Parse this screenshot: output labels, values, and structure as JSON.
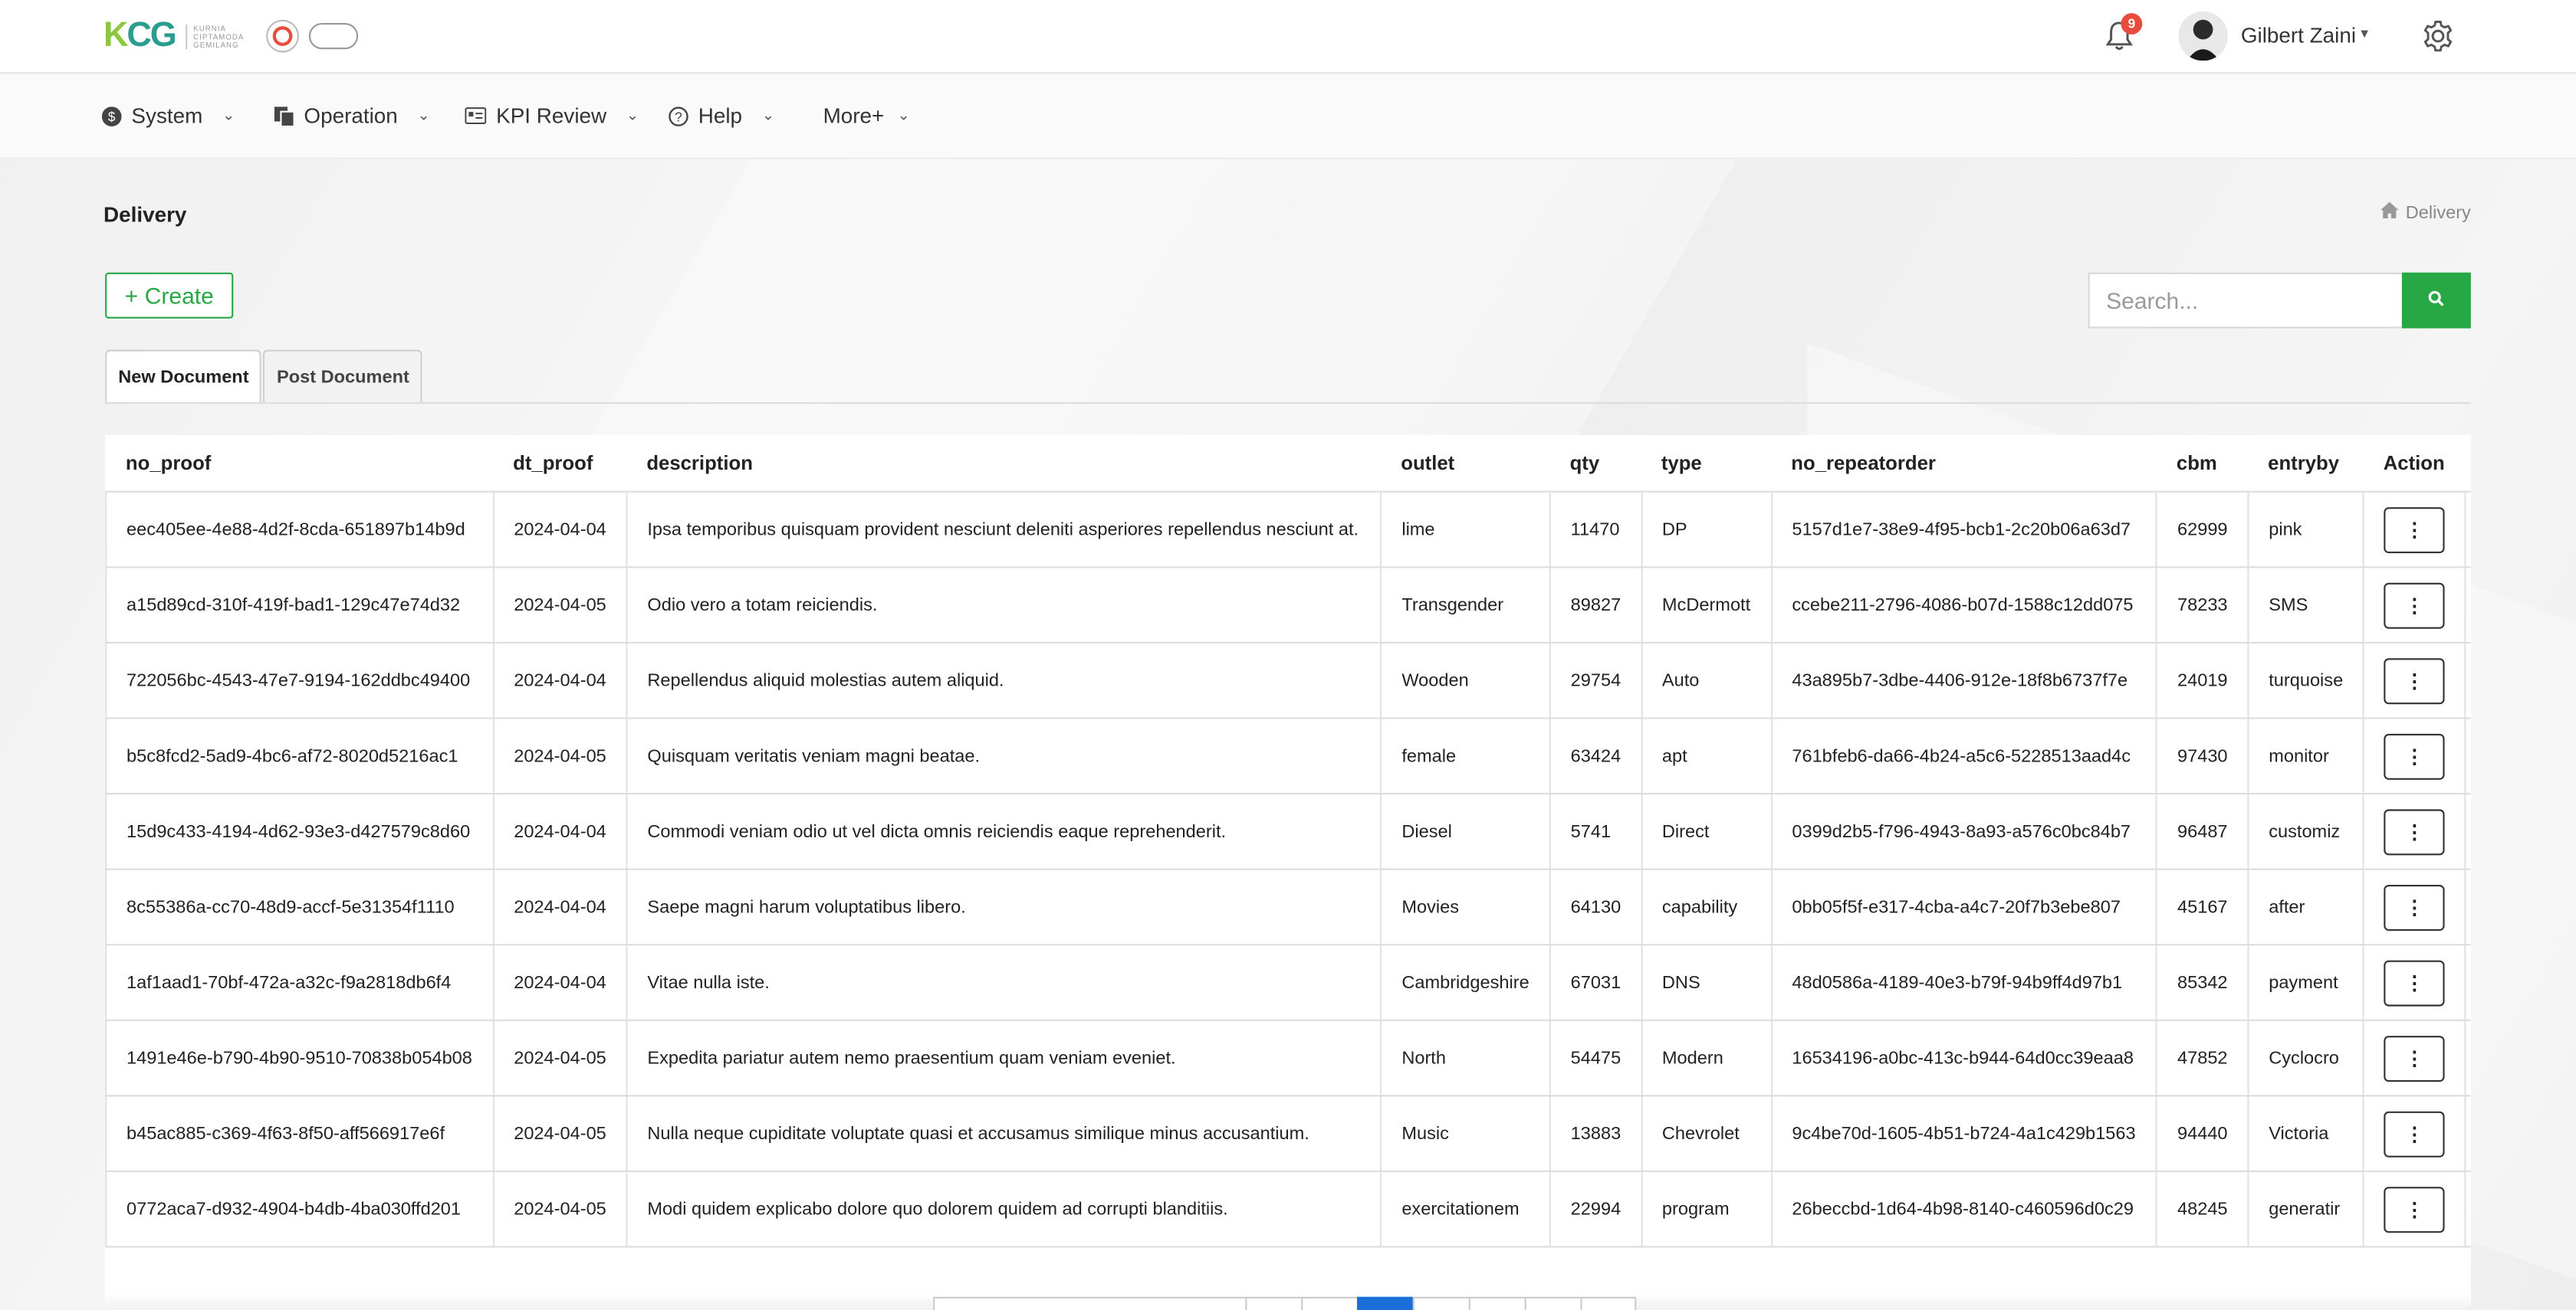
{
  "brand": {
    "logo_text": "KCG",
    "logo_sub": "KURNIA CIPTAMODA GEMILANG"
  },
  "header": {
    "notification_count": "9",
    "user_name": "Gilbert Zaini"
  },
  "nav": {
    "items": [
      {
        "label": "System",
        "icon": "dollar-circle-icon"
      },
      {
        "label": "Operation",
        "icon": "documents-icon"
      },
      {
        "label": "KPI Review",
        "icon": "id-card-icon"
      },
      {
        "label": "Help",
        "icon": "question-circle-icon"
      },
      {
        "label": "More+",
        "icon": ""
      }
    ]
  },
  "page": {
    "title": "Delivery",
    "breadcrumb": "Delivery",
    "create_label": "Create",
    "search_placeholder": "Search..."
  },
  "tabs": [
    {
      "label": "New Document",
      "active": true
    },
    {
      "label": "Post Document",
      "active": false
    }
  ],
  "table": {
    "columns": [
      "no_proof",
      "dt_proof",
      "description",
      "outlet",
      "qty",
      "type",
      "no_repeatorder",
      "cbm",
      "entryby",
      "Action"
    ],
    "rows": [
      [
        "eec405ee-4e88-4d2f-8cda-651897b14b9d",
        "2024-04-04",
        "Ipsa temporibus quisquam provident nesciunt deleniti asperiores repellendus nesciunt at.",
        "lime",
        "11470",
        "DP",
        "5157d1e7-38e9-4f95-bcb1-2c20b06a63d7",
        "62999",
        "pink"
      ],
      [
        "a15d89cd-310f-419f-bad1-129c47e74d32",
        "2024-04-05",
        "Odio vero a totam reiciendis.",
        "Transgender",
        "89827",
        "McDermott",
        "ccebe211-2796-4086-b07d-1588c12dd075",
        "78233",
        "SMS"
      ],
      [
        "722056bc-4543-47e7-9194-162ddbc49400",
        "2024-04-04",
        "Repellendus aliquid molestias autem aliquid.",
        "Wooden",
        "29754",
        "Auto",
        "43a895b7-3dbe-4406-912e-18f8b6737f7e",
        "24019",
        "turquoise"
      ],
      [
        "b5c8fcd2-5ad9-4bc6-af72-8020d5216ac1",
        "2024-04-05",
        "Quisquam veritatis veniam magni beatae.",
        "female",
        "63424",
        "apt",
        "761bfeb6-da66-4b24-a5c6-5228513aad4c",
        "97430",
        "monitor"
      ],
      [
        "15d9c433-4194-4d62-93e3-d427579c8d60",
        "2024-04-04",
        "Commodi veniam odio ut vel dicta omnis reiciendis eaque reprehenderit.",
        "Diesel",
        "5741",
        "Direct",
        "0399d2b5-f796-4943-8a93-a576c0bc84b7",
        "96487",
        "customiz"
      ],
      [
        "8c55386a-cc70-48d9-accf-5e31354f1110",
        "2024-04-04",
        "Saepe magni harum voluptatibus libero.",
        "Movies",
        "64130",
        "capability",
        "0bb05f5f-e317-4cba-a4c7-20f7b3ebe807",
        "45167",
        "after"
      ],
      [
        "1af1aad1-70bf-472a-a32c-f9a2818db6f4",
        "2024-04-04",
        "Vitae nulla iste.",
        "Cambridgeshire",
        "67031",
        "DNS",
        "48d0586a-4189-40e3-b79f-94b9ff4d97b1",
        "85342",
        "payment"
      ],
      [
        "1491e46e-b790-4b90-9510-70838b054b08",
        "2024-04-05",
        "Expedita pariatur autem nemo praesentium quam veniam eveniet.",
        "North",
        "54475",
        "Modern",
        "16534196-a0bc-413c-b944-64d0cc39eaa8",
        "47852",
        "Cyclocro"
      ],
      [
        "b45ac885-c369-4f63-8f50-aff566917e6f",
        "2024-04-05",
        "Nulla neque cupiditate voluptate quasi et accusamus similique minus accusantium.",
        "Music",
        "13883",
        "Chevrolet",
        "9c4be70d-1605-4b51-b724-4a1c429b1563",
        "94440",
        "Victoria"
      ],
      [
        "0772aca7-d932-4904-b4db-4ba030ffd201",
        "2024-04-05",
        "Modi quidem explicabo dolore quo dolorem quidem ad corrupti blanditiis.",
        "exercitationem",
        "22994",
        "program",
        "26beccbd-1d64-4b98-8140-c460596d0c29",
        "48245",
        "generatir"
      ]
    ]
  },
  "colors": {
    "accent": "#28a745",
    "pagination_active": "#1a6fd8",
    "notification": "#e74c3c"
  }
}
